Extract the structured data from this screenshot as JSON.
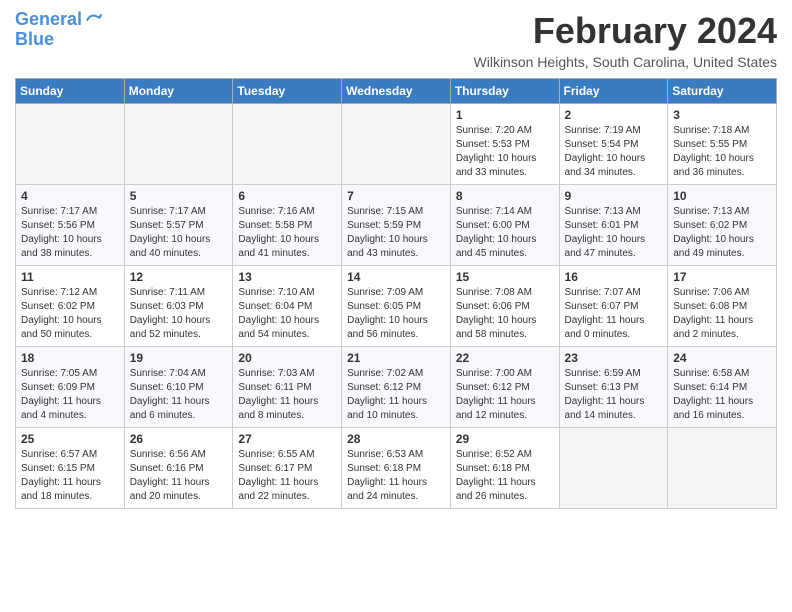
{
  "header": {
    "logo_line1": "General",
    "logo_line2": "Blue",
    "main_title": "February 2024",
    "subtitle": "Wilkinson Heights, South Carolina, United States"
  },
  "calendar": {
    "days_of_week": [
      "Sunday",
      "Monday",
      "Tuesday",
      "Wednesday",
      "Thursday",
      "Friday",
      "Saturday"
    ],
    "weeks": [
      [
        {
          "day": "",
          "info": ""
        },
        {
          "day": "",
          "info": ""
        },
        {
          "day": "",
          "info": ""
        },
        {
          "day": "",
          "info": ""
        },
        {
          "day": "1",
          "info": "Sunrise: 7:20 AM\nSunset: 5:53 PM\nDaylight: 10 hours\nand 33 minutes."
        },
        {
          "day": "2",
          "info": "Sunrise: 7:19 AM\nSunset: 5:54 PM\nDaylight: 10 hours\nand 34 minutes."
        },
        {
          "day": "3",
          "info": "Sunrise: 7:18 AM\nSunset: 5:55 PM\nDaylight: 10 hours\nand 36 minutes."
        }
      ],
      [
        {
          "day": "4",
          "info": "Sunrise: 7:17 AM\nSunset: 5:56 PM\nDaylight: 10 hours\nand 38 minutes."
        },
        {
          "day": "5",
          "info": "Sunrise: 7:17 AM\nSunset: 5:57 PM\nDaylight: 10 hours\nand 40 minutes."
        },
        {
          "day": "6",
          "info": "Sunrise: 7:16 AM\nSunset: 5:58 PM\nDaylight: 10 hours\nand 41 minutes."
        },
        {
          "day": "7",
          "info": "Sunrise: 7:15 AM\nSunset: 5:59 PM\nDaylight: 10 hours\nand 43 minutes."
        },
        {
          "day": "8",
          "info": "Sunrise: 7:14 AM\nSunset: 6:00 PM\nDaylight: 10 hours\nand 45 minutes."
        },
        {
          "day": "9",
          "info": "Sunrise: 7:13 AM\nSunset: 6:01 PM\nDaylight: 10 hours\nand 47 minutes."
        },
        {
          "day": "10",
          "info": "Sunrise: 7:13 AM\nSunset: 6:02 PM\nDaylight: 10 hours\nand 49 minutes."
        }
      ],
      [
        {
          "day": "11",
          "info": "Sunrise: 7:12 AM\nSunset: 6:02 PM\nDaylight: 10 hours\nand 50 minutes."
        },
        {
          "day": "12",
          "info": "Sunrise: 7:11 AM\nSunset: 6:03 PM\nDaylight: 10 hours\nand 52 minutes."
        },
        {
          "day": "13",
          "info": "Sunrise: 7:10 AM\nSunset: 6:04 PM\nDaylight: 10 hours\nand 54 minutes."
        },
        {
          "day": "14",
          "info": "Sunrise: 7:09 AM\nSunset: 6:05 PM\nDaylight: 10 hours\nand 56 minutes."
        },
        {
          "day": "15",
          "info": "Sunrise: 7:08 AM\nSunset: 6:06 PM\nDaylight: 10 hours\nand 58 minutes."
        },
        {
          "day": "16",
          "info": "Sunrise: 7:07 AM\nSunset: 6:07 PM\nDaylight: 11 hours\nand 0 minutes."
        },
        {
          "day": "17",
          "info": "Sunrise: 7:06 AM\nSunset: 6:08 PM\nDaylight: 11 hours\nand 2 minutes."
        }
      ],
      [
        {
          "day": "18",
          "info": "Sunrise: 7:05 AM\nSunset: 6:09 PM\nDaylight: 11 hours\nand 4 minutes."
        },
        {
          "day": "19",
          "info": "Sunrise: 7:04 AM\nSunset: 6:10 PM\nDaylight: 11 hours\nand 6 minutes."
        },
        {
          "day": "20",
          "info": "Sunrise: 7:03 AM\nSunset: 6:11 PM\nDaylight: 11 hours\nand 8 minutes."
        },
        {
          "day": "21",
          "info": "Sunrise: 7:02 AM\nSunset: 6:12 PM\nDaylight: 11 hours\nand 10 minutes."
        },
        {
          "day": "22",
          "info": "Sunrise: 7:00 AM\nSunset: 6:12 PM\nDaylight: 11 hours\nand 12 minutes."
        },
        {
          "day": "23",
          "info": "Sunrise: 6:59 AM\nSunset: 6:13 PM\nDaylight: 11 hours\nand 14 minutes."
        },
        {
          "day": "24",
          "info": "Sunrise: 6:58 AM\nSunset: 6:14 PM\nDaylight: 11 hours\nand 16 minutes."
        }
      ],
      [
        {
          "day": "25",
          "info": "Sunrise: 6:57 AM\nSunset: 6:15 PM\nDaylight: 11 hours\nand 18 minutes."
        },
        {
          "day": "26",
          "info": "Sunrise: 6:56 AM\nSunset: 6:16 PM\nDaylight: 11 hours\nand 20 minutes."
        },
        {
          "day": "27",
          "info": "Sunrise: 6:55 AM\nSunset: 6:17 PM\nDaylight: 11 hours\nand 22 minutes."
        },
        {
          "day": "28",
          "info": "Sunrise: 6:53 AM\nSunset: 6:18 PM\nDaylight: 11 hours\nand 24 minutes."
        },
        {
          "day": "29",
          "info": "Sunrise: 6:52 AM\nSunset: 6:18 PM\nDaylight: 11 hours\nand 26 minutes."
        },
        {
          "day": "",
          "info": ""
        },
        {
          "day": "",
          "info": ""
        }
      ]
    ]
  }
}
